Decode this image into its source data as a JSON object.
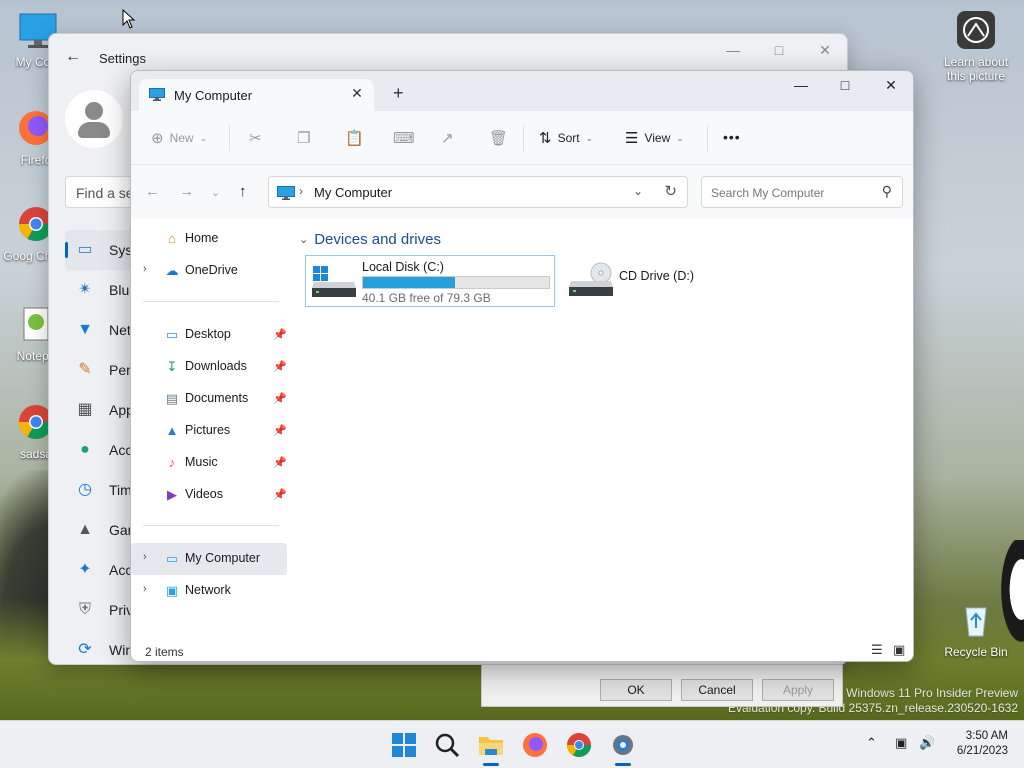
{
  "desktop": {
    "icons_left": [
      {
        "label": "My Com",
        "icon": "my-computer-icon"
      },
      {
        "label": "Firefo",
        "icon": "firefox-icon"
      },
      {
        "label": "Goog Chron",
        "icon": "chrome-icon"
      },
      {
        "label": "Notepa",
        "icon": "notepad-icon"
      },
      {
        "label": "sadsa",
        "icon": "chrome-icon"
      }
    ],
    "learn_picture": "Learn about this picture",
    "recycle_bin": "Recycle Bin",
    "watermark_line1": "Windows 11 Pro Insider Preview",
    "watermark_line2": "Evaluation copy. Build 25375.zn_release.230520-1632"
  },
  "settings": {
    "title": "Settings",
    "find_placeholder": "Find a se",
    "nav": [
      {
        "label": "Syst",
        "icon": "system-icon"
      },
      {
        "label": "Blue",
        "icon": "bluetooth-icon"
      },
      {
        "label": "Net",
        "icon": "network-icon"
      },
      {
        "label": "Pers",
        "icon": "personalization-icon"
      },
      {
        "label": "App",
        "icon": "apps-icon"
      },
      {
        "label": "Acc",
        "icon": "accounts-icon"
      },
      {
        "label": "Tim",
        "icon": "time-icon"
      },
      {
        "label": "Gan",
        "icon": "gaming-icon"
      },
      {
        "label": "Acc",
        "icon": "accessibility-icon"
      },
      {
        "label": "Priv",
        "icon": "privacy-icon"
      },
      {
        "label": "Win",
        "icon": "windows-update-icon"
      }
    ]
  },
  "dialog": {
    "ok": "OK",
    "cancel": "Cancel",
    "apply": "Apply"
  },
  "explorer": {
    "tab_label": "My Computer",
    "toolbar": {
      "new": "New",
      "sort": "Sort",
      "view": "View",
      "more": "•••"
    },
    "address": {
      "path": "My Computer",
      "search_placeholder": "Search My Computer"
    },
    "sidebar": {
      "home": "Home",
      "onedrive": "OneDrive",
      "quick": [
        {
          "label": "Desktop",
          "icon": "desktop-folder-icon",
          "color": "#2f8fd6"
        },
        {
          "label": "Downloads",
          "icon": "downloads-icon",
          "color": "#1e9e6a"
        },
        {
          "label": "Documents",
          "icon": "documents-icon",
          "color": "#6b7b8c"
        },
        {
          "label": "Pictures",
          "icon": "pictures-icon",
          "color": "#2a7ed1"
        },
        {
          "label": "Music",
          "icon": "music-icon",
          "color": "#e15a4f"
        },
        {
          "label": "Videos",
          "icon": "videos-icon",
          "color": "#7b3fc4"
        }
      ],
      "my_computer": "My Computer",
      "network": "Network"
    },
    "content": {
      "group_title": "Devices and drives",
      "drives": [
        {
          "name": "Local Disk (C:)",
          "free": "40.1 GB free of 79.3 GB",
          "used_fraction": 0.494
        },
        {
          "name": "CD Drive (D:)"
        }
      ]
    },
    "status": {
      "count": "2 items"
    }
  },
  "taskbar": {
    "time": "3:50 AM",
    "date": "6/21/2023"
  },
  "colors": {
    "accent": "#0067c0",
    "drive_bar": "#26a0da",
    "group_header": "#1a4e8c"
  }
}
